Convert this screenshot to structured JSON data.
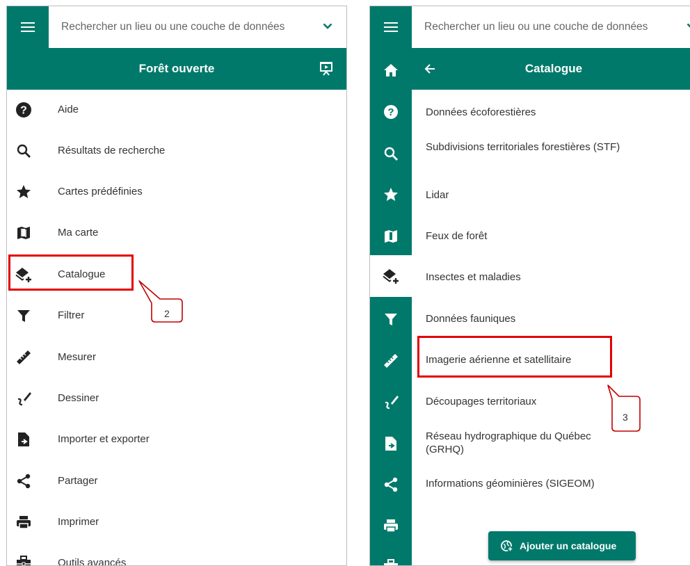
{
  "search": {
    "placeholder": "Rechercher un lieu ou une couche de données"
  },
  "left": {
    "header_title": "Forêt ouverte",
    "menu": [
      {
        "label": "Aide",
        "icon": "help-icon"
      },
      {
        "label": "Résultats de recherche",
        "icon": "search-icon"
      },
      {
        "label": "Cartes prédéfinies",
        "icon": "star-icon"
      },
      {
        "label": "Ma carte",
        "icon": "map-icon"
      },
      {
        "label": "Catalogue",
        "icon": "layers-add-icon"
      },
      {
        "label": "Filtrer",
        "icon": "filter-icon"
      },
      {
        "label": "Mesurer",
        "icon": "ruler-icon"
      },
      {
        "label": "Dessiner",
        "icon": "draw-icon"
      },
      {
        "label": "Importer et exporter",
        "icon": "file-import-export-icon"
      },
      {
        "label": "Partager",
        "icon": "share-icon"
      },
      {
        "label": "Imprimer",
        "icon": "print-icon"
      },
      {
        "label": "Outils avancés",
        "icon": "toolbox-icon"
      }
    ]
  },
  "right": {
    "header_title": "Catalogue",
    "items": [
      {
        "label": "Données écoforestières"
      },
      {
        "label": "Subdivisions territoriales forestières (STF)"
      },
      {
        "label": "Lidar"
      },
      {
        "label": "Feux de forêt"
      },
      {
        "label": "Insectes et maladies"
      },
      {
        "label": "Données fauniques"
      },
      {
        "label": "Imagerie aérienne et satellitaire"
      },
      {
        "label": "Découpages territoriaux"
      },
      {
        "label": "Réseau hydrographique du Québec (GRHQ)"
      },
      {
        "label": "Informations géominières (SIGEOM)"
      }
    ],
    "add_button": "Ajouter un catalogue"
  },
  "annotations": {
    "step2": "2",
    "step3": "3"
  },
  "colors": {
    "teal": "#00796b",
    "highlight": "#e30000"
  }
}
